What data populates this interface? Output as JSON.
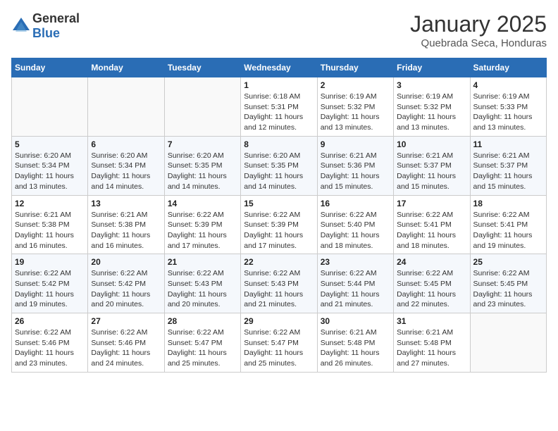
{
  "header": {
    "logo": {
      "general": "General",
      "blue": "Blue"
    },
    "title": "January 2025",
    "subtitle": "Quebrada Seca, Honduras"
  },
  "calendar": {
    "days_of_week": [
      "Sunday",
      "Monday",
      "Tuesday",
      "Wednesday",
      "Thursday",
      "Friday",
      "Saturday"
    ],
    "weeks": [
      [
        {
          "day": "",
          "info": ""
        },
        {
          "day": "",
          "info": ""
        },
        {
          "day": "",
          "info": ""
        },
        {
          "day": "1",
          "info": "Sunrise: 6:18 AM\nSunset: 5:31 PM\nDaylight: 11 hours and 12 minutes."
        },
        {
          "day": "2",
          "info": "Sunrise: 6:19 AM\nSunset: 5:32 PM\nDaylight: 11 hours and 13 minutes."
        },
        {
          "day": "3",
          "info": "Sunrise: 6:19 AM\nSunset: 5:32 PM\nDaylight: 11 hours and 13 minutes."
        },
        {
          "day": "4",
          "info": "Sunrise: 6:19 AM\nSunset: 5:33 PM\nDaylight: 11 hours and 13 minutes."
        }
      ],
      [
        {
          "day": "5",
          "info": "Sunrise: 6:20 AM\nSunset: 5:34 PM\nDaylight: 11 hours and 13 minutes."
        },
        {
          "day": "6",
          "info": "Sunrise: 6:20 AM\nSunset: 5:34 PM\nDaylight: 11 hours and 14 minutes."
        },
        {
          "day": "7",
          "info": "Sunrise: 6:20 AM\nSunset: 5:35 PM\nDaylight: 11 hours and 14 minutes."
        },
        {
          "day": "8",
          "info": "Sunrise: 6:20 AM\nSunset: 5:35 PM\nDaylight: 11 hours and 14 minutes."
        },
        {
          "day": "9",
          "info": "Sunrise: 6:21 AM\nSunset: 5:36 PM\nDaylight: 11 hours and 15 minutes."
        },
        {
          "day": "10",
          "info": "Sunrise: 6:21 AM\nSunset: 5:37 PM\nDaylight: 11 hours and 15 minutes."
        },
        {
          "day": "11",
          "info": "Sunrise: 6:21 AM\nSunset: 5:37 PM\nDaylight: 11 hours and 15 minutes."
        }
      ],
      [
        {
          "day": "12",
          "info": "Sunrise: 6:21 AM\nSunset: 5:38 PM\nDaylight: 11 hours and 16 minutes."
        },
        {
          "day": "13",
          "info": "Sunrise: 6:21 AM\nSunset: 5:38 PM\nDaylight: 11 hours and 16 minutes."
        },
        {
          "day": "14",
          "info": "Sunrise: 6:22 AM\nSunset: 5:39 PM\nDaylight: 11 hours and 17 minutes."
        },
        {
          "day": "15",
          "info": "Sunrise: 6:22 AM\nSunset: 5:39 PM\nDaylight: 11 hours and 17 minutes."
        },
        {
          "day": "16",
          "info": "Sunrise: 6:22 AM\nSunset: 5:40 PM\nDaylight: 11 hours and 18 minutes."
        },
        {
          "day": "17",
          "info": "Sunrise: 6:22 AM\nSunset: 5:41 PM\nDaylight: 11 hours and 18 minutes."
        },
        {
          "day": "18",
          "info": "Sunrise: 6:22 AM\nSunset: 5:41 PM\nDaylight: 11 hours and 19 minutes."
        }
      ],
      [
        {
          "day": "19",
          "info": "Sunrise: 6:22 AM\nSunset: 5:42 PM\nDaylight: 11 hours and 19 minutes."
        },
        {
          "day": "20",
          "info": "Sunrise: 6:22 AM\nSunset: 5:42 PM\nDaylight: 11 hours and 20 minutes."
        },
        {
          "day": "21",
          "info": "Sunrise: 6:22 AM\nSunset: 5:43 PM\nDaylight: 11 hours and 20 minutes."
        },
        {
          "day": "22",
          "info": "Sunrise: 6:22 AM\nSunset: 5:43 PM\nDaylight: 11 hours and 21 minutes."
        },
        {
          "day": "23",
          "info": "Sunrise: 6:22 AM\nSunset: 5:44 PM\nDaylight: 11 hours and 21 minutes."
        },
        {
          "day": "24",
          "info": "Sunrise: 6:22 AM\nSunset: 5:45 PM\nDaylight: 11 hours and 22 minutes."
        },
        {
          "day": "25",
          "info": "Sunrise: 6:22 AM\nSunset: 5:45 PM\nDaylight: 11 hours and 23 minutes."
        }
      ],
      [
        {
          "day": "26",
          "info": "Sunrise: 6:22 AM\nSunset: 5:46 PM\nDaylight: 11 hours and 23 minutes."
        },
        {
          "day": "27",
          "info": "Sunrise: 6:22 AM\nSunset: 5:46 PM\nDaylight: 11 hours and 24 minutes."
        },
        {
          "day": "28",
          "info": "Sunrise: 6:22 AM\nSunset: 5:47 PM\nDaylight: 11 hours and 25 minutes."
        },
        {
          "day": "29",
          "info": "Sunrise: 6:22 AM\nSunset: 5:47 PM\nDaylight: 11 hours and 25 minutes."
        },
        {
          "day": "30",
          "info": "Sunrise: 6:21 AM\nSunset: 5:48 PM\nDaylight: 11 hours and 26 minutes."
        },
        {
          "day": "31",
          "info": "Sunrise: 6:21 AM\nSunset: 5:48 PM\nDaylight: 11 hours and 27 minutes."
        },
        {
          "day": "",
          "info": ""
        }
      ]
    ]
  }
}
